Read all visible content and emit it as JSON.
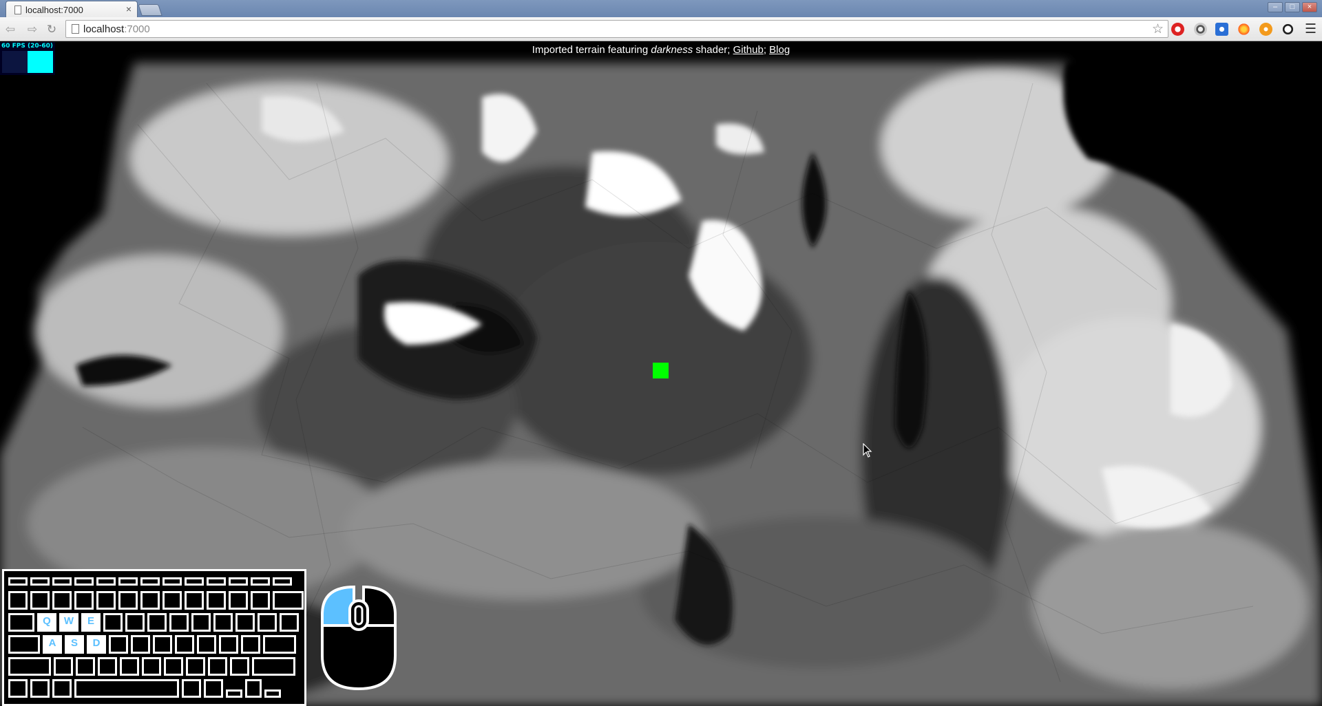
{
  "browser": {
    "tab_title": "localhost:7000",
    "tab_close": "×",
    "url_host": "localhost",
    "url_port": ":7000",
    "window_controls": [
      "–",
      "□",
      "×"
    ],
    "extension_icons": [
      "red-stop-icon",
      "steering-wheel-icon",
      "blue-square-icon",
      "fire-icon",
      "orange-rss-icon",
      "sync-icon"
    ]
  },
  "page": {
    "info_prefix": "Imported terrain featuring ",
    "info_emphasis": "darkness",
    "info_suffix": " shader; ",
    "github_link": "Github",
    "separator": ";",
    "blog_link": "Blog"
  },
  "stats": {
    "fps_label": "60 FPS (20-60)",
    "fps": 60,
    "fps_min": 20,
    "fps_max": 60
  },
  "overlay": {
    "highlighted_keys": [
      "Q",
      "W",
      "E",
      "A",
      "S",
      "D"
    ],
    "mouse_highlight": "left-button",
    "crosshair_color": "#00ff00",
    "highlight_color": "#5cc0ff"
  }
}
